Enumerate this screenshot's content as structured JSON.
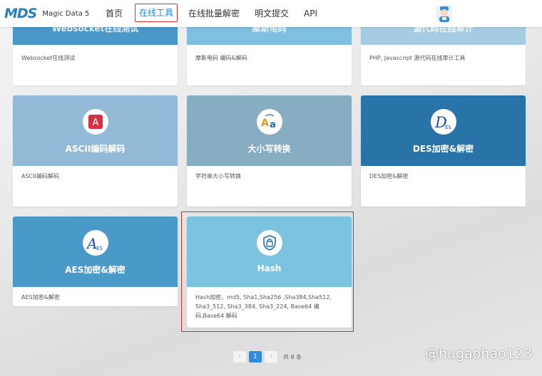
{
  "header": {
    "logo_mark": "MDS",
    "logo_text": "Magic Data 5",
    "nav": [
      {
        "label": "首页"
      },
      {
        "label": "在线工具"
      },
      {
        "label": "在线批量解密"
      },
      {
        "label": "明文提交"
      },
      {
        "label": "API"
      }
    ]
  },
  "cards": [
    {
      "title": "Websocket在线测试",
      "desc": "Websocket在线测试",
      "color": "#4a97c9"
    },
    {
      "title": "摩斯电码",
      "desc": "摩斯电码 编码&解码",
      "color": "#7fbfdf"
    },
    {
      "title": "源代码在线审计",
      "desc": "PHP, Javascript 源代码在线审计工具",
      "color": "#a6cce3"
    },
    {
      "title": "ASCII编码解码",
      "desc": "ASCII编码解码",
      "color": "#92bad6",
      "icon": "ascii-icon"
    },
    {
      "title": "大小写转换",
      "desc": "字符串大小写转换",
      "color": "#87adc3",
      "icon": "case-convert-icon"
    },
    {
      "title": "DES加密&解密",
      "desc": "DES加密&解密",
      "color": "#2874a8",
      "icon": "des-icon",
      "icon_text": "D",
      "icon_sub": "ES"
    },
    {
      "title": "AES加密&解密",
      "desc": "AES加密&解密",
      "color": "#4a9ac9",
      "icon": "aes-icon",
      "icon_text": "A",
      "icon_sub": "ES"
    },
    {
      "title": "Hash",
      "desc": "Hash加密，md5, Sha1,Sha256 ,Sha384,Sha512, Sha3_512, Sha3_384, Sha3_224, Base64 编码,Base64 解码",
      "color": "#7cc3e0",
      "icon": "hash-lock-icon"
    }
  ],
  "pagination": {
    "prev": "‹",
    "current": "1",
    "next": "›",
    "total": "共 8 条"
  },
  "watermark": "@hugaohao123",
  "colors": {
    "accent": "#1e88d6",
    "highlight": "#d9302a",
    "page_btn": "#2d8ce0"
  }
}
